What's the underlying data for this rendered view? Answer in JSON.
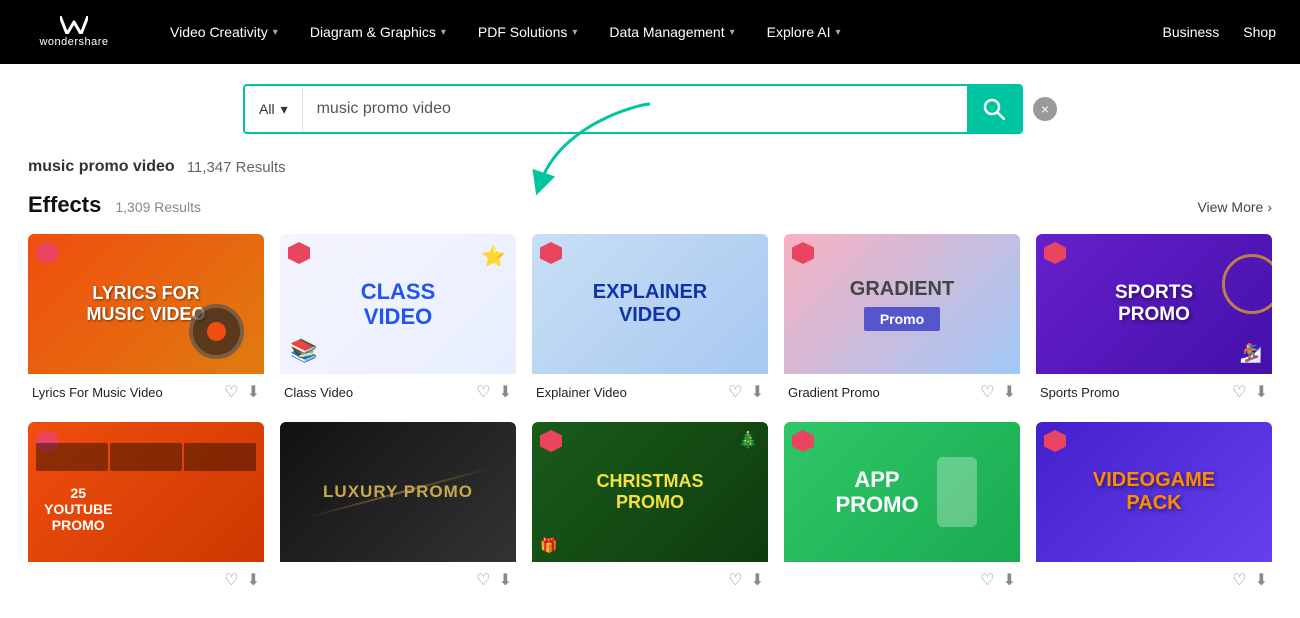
{
  "brand": {
    "name": "wondershare",
    "logo_symbol": "W"
  },
  "nav": {
    "items": [
      {
        "label": "Video Creativity",
        "has_dropdown": true
      },
      {
        "label": "Diagram & Graphics",
        "has_dropdown": true
      },
      {
        "label": "PDF Solutions",
        "has_dropdown": true
      },
      {
        "label": "Data Management",
        "has_dropdown": true
      },
      {
        "label": "Explore AI",
        "has_dropdown": true
      }
    ],
    "right_items": [
      {
        "label": "Business"
      },
      {
        "label": "Shop"
      }
    ]
  },
  "search": {
    "category_label": "All",
    "query": "music promo video",
    "placeholder": "music promo video",
    "clear_label": "×"
  },
  "results": {
    "query": "music promo video",
    "count": "11,347 Results"
  },
  "effects_section": {
    "title": "Effects",
    "count": "1,309 Results",
    "view_more_label": "View More"
  },
  "row1_cards": [
    {
      "name": "Lyrics For Music Video",
      "thumb_style": "lyrics",
      "thumb_text": "LYRICS FOR\nMUSIC VIDEO",
      "thumb_color": "white"
    },
    {
      "name": "Class Video",
      "thumb_style": "class",
      "thumb_text": "CLASS\nVIDEO",
      "thumb_color": "blue"
    },
    {
      "name": "Explainer Video",
      "thumb_style": "explainer",
      "thumb_text": "EXPLAINER\nVIDEO",
      "thumb_color": "blue"
    },
    {
      "name": "Gradient Promo",
      "thumb_style": "gradient",
      "thumb_text": "GRADIENT\nPromo",
      "thumb_color": "white"
    },
    {
      "name": "Sports Promo",
      "thumb_style": "sports",
      "thumb_text": "SPORTS PROMO",
      "thumb_color": "white"
    }
  ],
  "row2_cards": [
    {
      "name": "",
      "thumb_style": "youtube",
      "thumb_text": "25\nYOUTUBE\nPROMO",
      "thumb_color": "white"
    },
    {
      "name": "",
      "thumb_style": "luxury",
      "thumb_text": "LUXURY PROMO",
      "thumb_color": "gold"
    },
    {
      "name": "",
      "thumb_style": "christmas",
      "thumb_text": "CHRISTMAS\nPROMO",
      "thumb_color": "yellow"
    },
    {
      "name": "",
      "thumb_style": "app",
      "thumb_text": "APP\nPROMO",
      "thumb_color": "white"
    },
    {
      "name": "",
      "thumb_style": "videogame",
      "thumb_text": "VIDEOGAME\nPACK",
      "thumb_color": "orange"
    }
  ],
  "icons": {
    "search": "🔍",
    "heart": "♡",
    "download": "⬇",
    "chevron_down": "▾",
    "chevron_right": "›"
  }
}
